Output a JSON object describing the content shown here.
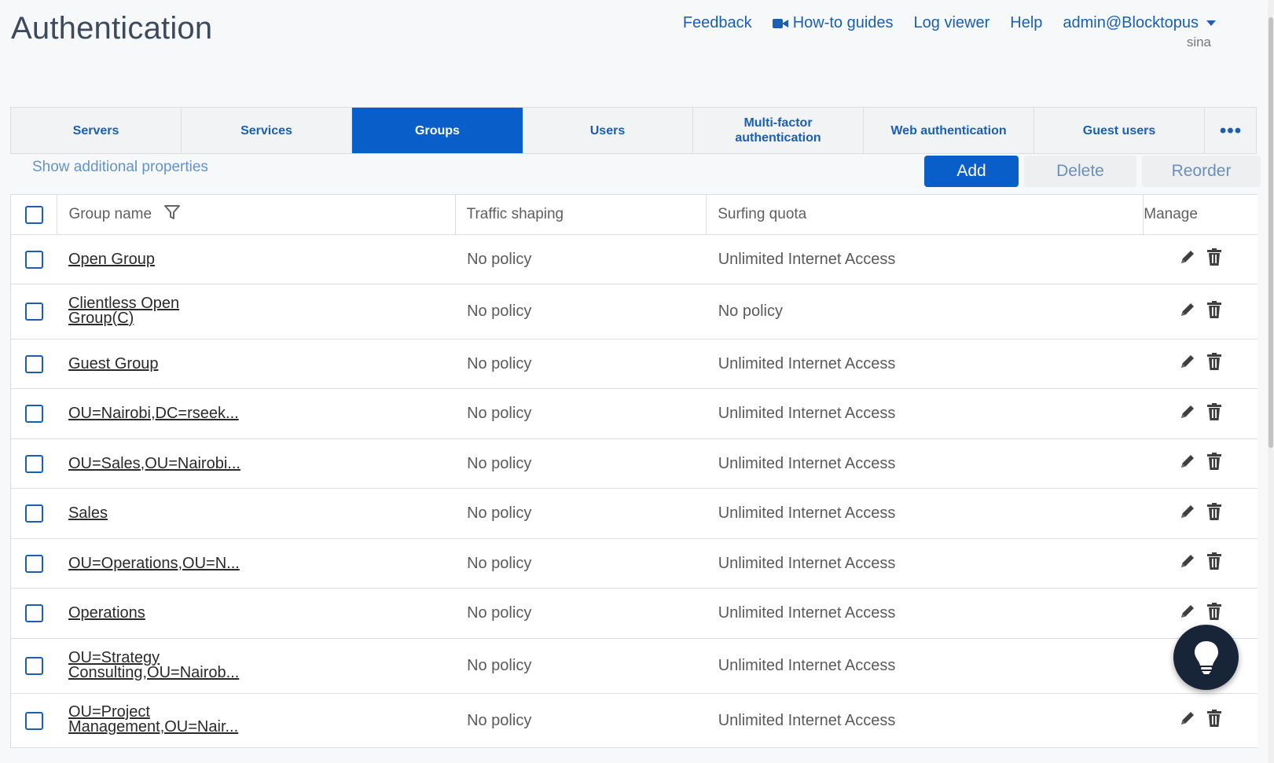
{
  "page": {
    "title": "Authentication"
  },
  "topnav": {
    "feedback": "Feedback",
    "howto": "How-to guides",
    "logviewer": "Log viewer",
    "help": "Help",
    "admin": "admin@Blocktopus",
    "subuser": "sina"
  },
  "tabs": [
    {
      "label": "Servers"
    },
    {
      "label": "Services"
    },
    {
      "label": "Groups"
    },
    {
      "label": "Users"
    },
    {
      "label": "Multi-factor authentication"
    },
    {
      "label": "Web authentication"
    },
    {
      "label": "Guest users"
    },
    {
      "label": "•••"
    }
  ],
  "toolbar": {
    "show_props": "Show additional properties",
    "add": "Add",
    "delete": "Delete",
    "reorder": "Reorder"
  },
  "table": {
    "headers": {
      "name": "Group name",
      "traffic": "Traffic shaping",
      "quota": "Surfing quota",
      "manage": "Manage"
    },
    "rows": [
      {
        "name": "Open Group",
        "traffic": "No policy",
        "quota": "Unlimited Internet Access"
      },
      {
        "name": "Clientless Open Group(C)",
        "traffic": "No policy",
        "quota": "No policy"
      },
      {
        "name": "Guest Group",
        "traffic": "No policy",
        "quota": "Unlimited Internet Access"
      },
      {
        "name": "OU=Nairobi,DC=rseek...",
        "traffic": "No policy",
        "quota": "Unlimited Internet Access"
      },
      {
        "name": "OU=Sales,OU=Nairobi...",
        "traffic": "No policy",
        "quota": "Unlimited Internet Access"
      },
      {
        "name": "Sales",
        "traffic": "No policy",
        "quota": "Unlimited Internet Access"
      },
      {
        "name": "OU=Operations,OU=N...",
        "traffic": "No policy",
        "quota": "Unlimited Internet Access"
      },
      {
        "name": "Operations",
        "traffic": "No policy",
        "quota": "Unlimited Internet Access"
      },
      {
        "name": "OU=Strategy Consulting,OU=Nairob...",
        "traffic": "No policy",
        "quota": "Unlimited Internet Access"
      },
      {
        "name": "OU=Project Management,OU=Nair...",
        "traffic": "No policy",
        "quota": "Unlimited Internet Access"
      }
    ]
  },
  "colors": {
    "accent": "#0a5ec9",
    "link": "#1a5fb4",
    "bulb": "#182437"
  }
}
